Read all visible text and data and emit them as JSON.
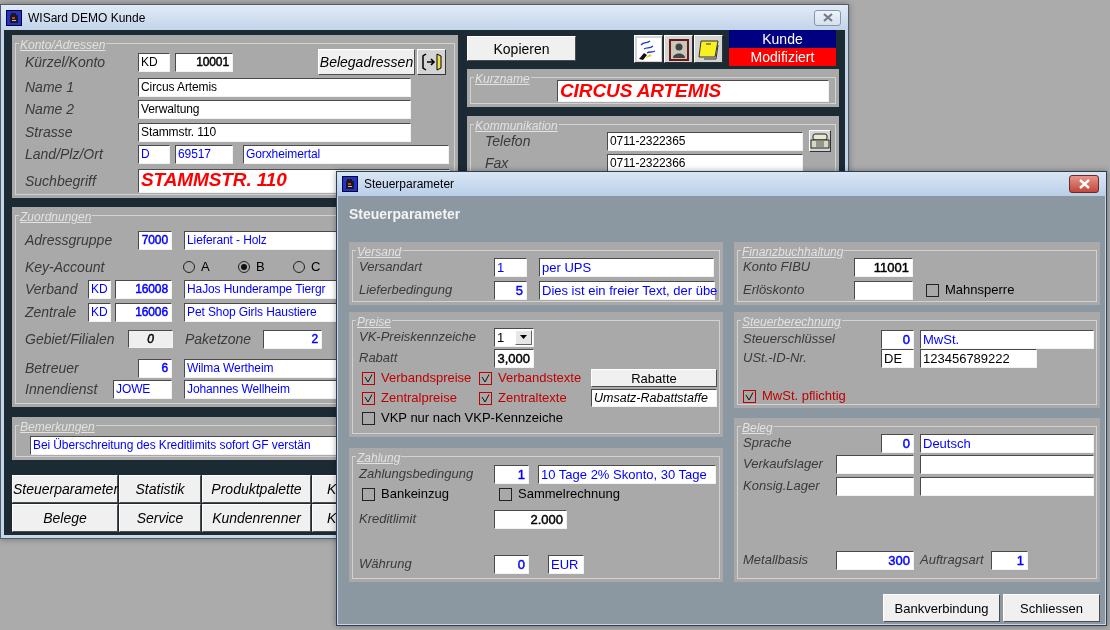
{
  "main_window": {
    "title": "WISard DEMO Kunde",
    "left_groups": [
      {
        "legend": "Konto/Adressen",
        "rows": [
          {
            "items": [
              {
                "kind": "label",
                "text": "Kürzel/Konto"
              },
              {
                "kind": "field",
                "value": "KD",
                "color": "#000000"
              },
              {
                "kind": "field",
                "value": "10001",
                "color": "#000000"
              },
              {
                "kind": "button",
                "text": "Belegadressen"
              },
              {
                "kind": "icon-button"
              }
            ]
          },
          {
            "items": [
              {
                "kind": "label",
                "text": "Name 1"
              },
              {
                "kind": "field",
                "value": "Circus Artemis",
                "color": "#000000"
              }
            ]
          },
          {
            "items": [
              {
                "kind": "label",
                "text": "Name 2"
              },
              {
                "kind": "field",
                "value": "Verwaltung",
                "color": "#000000"
              }
            ]
          },
          {
            "items": [
              {
                "kind": "label",
                "text": "Strasse"
              },
              {
                "kind": "field",
                "value": "Stammstr. 110",
                "color": "#000000"
              }
            ]
          },
          {
            "items": [
              {
                "kind": "label",
                "text": "Land/Plz/Ort"
              },
              {
                "kind": "field",
                "value": "D",
                "color": "#0000ff"
              },
              {
                "kind": "field",
                "value": "69517",
                "color": "#0000ff"
              },
              {
                "kind": "field",
                "value": "Gorxheimertal",
                "color": "#0000ff"
              }
            ]
          },
          {
            "items": [
              {
                "kind": "label",
                "text": "Suchbegriff"
              },
              {
                "kind": "big-field",
                "value": "STAMMSTR. 110",
                "color": "#ff0000"
              }
            ]
          }
        ]
      },
      {
        "legend": "Zuordnungen",
        "rows": [
          {
            "items": [
              {
                "kind": "label",
                "text": "Adressgruppe"
              },
              {
                "kind": "field",
                "value": "7000",
                "color": "#0000ff"
              },
              {
                "kind": "field",
                "value": "Lieferant - Holz",
                "color": "#0000ff"
              }
            ]
          },
          {
            "items": [
              {
                "kind": "label",
                "text": "Key-Account"
              },
              {
                "kind": "radio",
                "text": "A",
                "selected": false
              },
              {
                "kind": "radio",
                "text": "B",
                "selected": true
              },
              {
                "kind": "radio",
                "text": "C",
                "selected": false
              }
            ]
          },
          {
            "items": [
              {
                "kind": "label",
                "text": "Verband"
              },
              {
                "kind": "field",
                "value": "KD",
                "color": "#0000ff"
              },
              {
                "kind": "field",
                "value": "16008",
                "color": "#0000ff"
              },
              {
                "kind": "field",
                "value": "HaJos Hunderampe Tiergr",
                "color": "#0000ff"
              }
            ]
          },
          {
            "items": [
              {
                "kind": "label",
                "text": "Zentrale"
              },
              {
                "kind": "field",
                "value": "KD",
                "color": "#0000ff"
              },
              {
                "kind": "field",
                "value": "16006",
                "color": "#0000ff"
              },
              {
                "kind": "field",
                "value": "Pet Shop Girls Haustiere",
                "color": "#0000ff"
              }
            ]
          },
          {
            "items": [
              {
                "kind": "label",
                "text": "Gebiet/Filialen"
              },
              {
                "kind": "readonly-field",
                "value": "0",
                "color": "#000000"
              },
              {
                "kind": "label",
                "text": "Paketzone"
              },
              {
                "kind": "field",
                "value": "2",
                "color": "#0000ff"
              }
            ]
          },
          {
            "items": [
              {
                "kind": "label",
                "text": "Betreuer"
              },
              {
                "kind": "field",
                "value": "6",
                "color": "#0000ff"
              },
              {
                "kind": "field",
                "value": "Wilma Wertheim",
                "color": "#0000ff"
              }
            ]
          },
          {
            "items": [
              {
                "kind": "label",
                "text": "Innendienst"
              },
              {
                "kind": "field",
                "value": "JOWE",
                "color": "#0000ff"
              },
              {
                "kind": "field",
                "value": "Johannes Wellheim",
                "color": "#0000ff"
              }
            ]
          }
        ]
      },
      {
        "legend": "Bemerkungen",
        "rows": [
          {
            "items": [
              {
                "kind": "field",
                "value": "Bei Überschreitung des Kreditlimits sofort GF verstän",
                "color": "#0000ff"
              }
            ]
          }
        ]
      }
    ],
    "button_rows": [
      {
        "buttons": [
          "Steuerparameter",
          "Statistik",
          "Produktpalette",
          "K"
        ]
      },
      {
        "buttons": [
          "Belege",
          "Service",
          "Kundenrenner",
          "K"
        ]
      }
    ],
    "copy_button": "Kopieren",
    "status": [
      "Kunde",
      "Modifiziert"
    ],
    "right_groups": [
      {
        "legend": "Kurzname",
        "rows": [
          {
            "items": [
              {
                "kind": "big-field",
                "value": "CIRCUS ARTEMIS",
                "color": "#ff0000"
              }
            ]
          }
        ]
      },
      {
        "legend": "Kommunikation",
        "rows": [
          {
            "items": [
              {
                "kind": "label",
                "text": "Telefon"
              },
              {
                "kind": "field",
                "value": "0711-2322365",
                "color": "#000000"
              },
              {
                "kind": "icon-button"
              }
            ]
          },
          {
            "items": [
              {
                "kind": "label",
                "text": "Fax"
              },
              {
                "kind": "field",
                "value": "0711-2322366",
                "color": "#000000"
              }
            ]
          }
        ]
      }
    ]
  },
  "dialog": {
    "title": "Steuerparameter",
    "heading": "Steuerparameter",
    "left_groups": [
      {
        "legend": "Versand",
        "rows": [
          {
            "items": [
              {
                "kind": "label",
                "text": "Versandart"
              },
              {
                "kind": "field",
                "value": "1",
                "color": "#0000ff"
              },
              {
                "kind": "field",
                "value": "per UPS",
                "color": "#0000ff"
              }
            ]
          },
          {
            "items": [
              {
                "kind": "label",
                "text": "Lieferbedingung"
              },
              {
                "kind": "field",
                "value": "5",
                "color": "#0000ff"
              },
              {
                "kind": "field",
                "value": "Dies ist ein freier Text, der übe",
                "color": "#0000ff"
              }
            ]
          }
        ]
      },
      {
        "legend": "Preise",
        "rows": [
          {
            "items": [
              {
                "kind": "label",
                "text": "VK-Preiskennzeiche"
              },
              {
                "kind": "combo",
                "value": "1"
              }
            ]
          },
          {
            "items": [
              {
                "kind": "label",
                "text": "Rabatt"
              },
              {
                "kind": "field",
                "value": "3,000",
                "color": "#000000"
              }
            ]
          },
          {
            "items": [
              {
                "kind": "checkbox",
                "text": "Verbandspreise",
                "checked": true
              },
              {
                "kind": "checkbox",
                "text": "Verbandstexte",
                "checked": true
              },
              {
                "kind": "button",
                "text": "Rabatte"
              }
            ]
          },
          {
            "items": [
              {
                "kind": "checkbox",
                "text": "Zentralpreise",
                "checked": true
              },
              {
                "kind": "checkbox",
                "text": "Zentraltexte",
                "checked": true
              },
              {
                "kind": "note-field",
                "value": "Umsatz-Rabattstaffe",
                "color": "#000000"
              }
            ]
          },
          {
            "items": [
              {
                "kind": "checkbox",
                "text": "VKP nur nach VKP-Kennzeiche",
                "checked": false
              }
            ]
          }
        ]
      },
      {
        "legend": "Zahlung",
        "rows": [
          {
            "items": [
              {
                "kind": "label",
                "text": "Zahlungsbedingung"
              },
              {
                "kind": "field",
                "value": "1",
                "color": "#0000ff"
              },
              {
                "kind": "field",
                "value": "10 Tage 2% Skonto, 30 Tage",
                "color": "#0000ff"
              }
            ]
          },
          {
            "items": [
              {
                "kind": "checkbox",
                "text": "Bankeinzug",
                "checked": false
              },
              {
                "kind": "checkbox",
                "text": "Sammelrechnung",
                "checked": false
              }
            ]
          },
          {
            "items": [
              {
                "kind": "label",
                "text": "Kreditlimit"
              },
              {
                "kind": "field",
                "value": "2.000",
                "color": "#000000"
              }
            ]
          },
          {
            "items": [
              {
                "kind": "label",
                "text": "Währung"
              },
              {
                "kind": "field",
                "value": "0",
                "color": "#0000ff"
              },
              {
                "kind": "field",
                "value": "EUR",
                "color": "#0000ff"
              }
            ]
          }
        ]
      }
    ],
    "right_groups": [
      {
        "legend": "Finanzbuchhaltung",
        "rows": [
          {
            "items": [
              {
                "kind": "label",
                "text": "Konto FIBU"
              },
              {
                "kind": "field",
                "value": "11001",
                "color": "#000000"
              }
            ]
          },
          {
            "items": [
              {
                "kind": "label",
                "text": "Erlöskonto"
              },
              {
                "kind": "field"
              },
              {
                "kind": "checkbox",
                "text": "Mahnsperre",
                "checked": false
              }
            ]
          }
        ]
      },
      {
        "legend": "Steuerberechnung",
        "rows": [
          {
            "items": [
              {
                "kind": "label",
                "text": "Steuerschlüssel"
              },
              {
                "kind": "field",
                "value": "0",
                "color": "#0000ff"
              },
              {
                "kind": "field",
                "value": "MwSt.",
                "color": "#0000ff"
              }
            ]
          },
          {
            "items": [
              {
                "kind": "label",
                "text": "USt.-ID-Nr."
              },
              {
                "kind": "field",
                "value": "DE",
                "color": "#000000"
              },
              {
                "kind": "field",
                "value": "123456789222",
                "color": "#000000"
              }
            ]
          },
          {
            "items": [
              {
                "kind": "checkbox",
                "text": "MwSt. pflichtig",
                "checked": true
              }
            ]
          }
        ]
      },
      {
        "legend": "Beleg",
        "rows": [
          {
            "items": [
              {
                "kind": "label",
                "text": "Sprache"
              },
              {
                "kind": "field",
                "value": "0",
                "color": "#0000ff"
              },
              {
                "kind": "field",
                "value": "Deutsch",
                "color": "#0000ff"
              }
            ]
          },
          {
            "items": [
              {
                "kind": "label",
                "text": "Verkaufslager"
              },
              {
                "kind": "field"
              },
              {
                "kind": "field"
              }
            ]
          },
          {
            "items": [
              {
                "kind": "label",
                "text": "Konsig.Lager"
              },
              {
                "kind": "field"
              },
              {
                "kind": "field"
              }
            ]
          },
          {
            "items": [
              {
                "kind": "label",
                "text": "Metallbasis"
              },
              {
                "kind": "field",
                "value": "300",
                "color": "#0000ff"
              },
              {
                "kind": "label",
                "text": "Auftragsart"
              },
              {
                "kind": "field",
                "value": "1",
                "color": "#0000ff"
              }
            ]
          }
        ]
      }
    ],
    "buttons": [
      "Bankverbindung",
      "Schliessen"
    ]
  }
}
